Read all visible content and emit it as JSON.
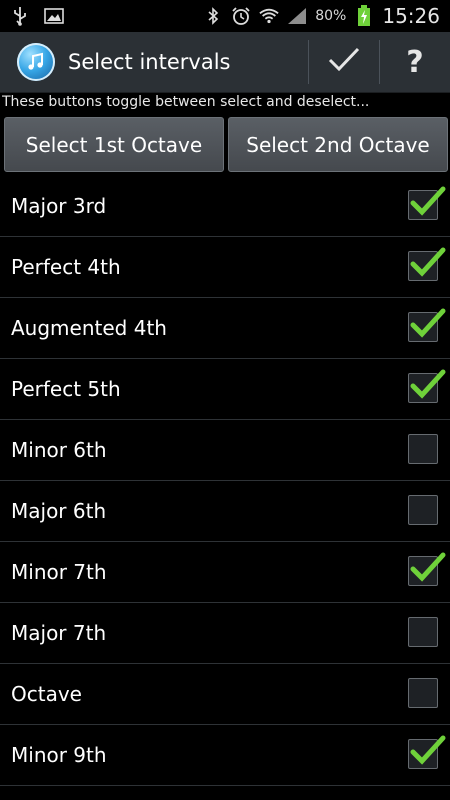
{
  "status_bar": {
    "battery_percent": "80%",
    "time": "15:26",
    "icons": [
      "usb-icon",
      "image-icon",
      "bluetooth-icon",
      "alarm-icon",
      "wifi-icon",
      "signal-icon",
      "battery-charging-icon"
    ]
  },
  "action_bar": {
    "title": "Select intervals",
    "app_icon": "music-app-icon",
    "confirm_icon": "checkmark-icon",
    "help_label": "?"
  },
  "hint_text": "These buttons toggle between select and deselect...",
  "buttons": {
    "first_octave": "Select 1st Octave",
    "second_octave": "Select 2nd Octave"
  },
  "intervals": [
    {
      "label": "Major 3rd",
      "checked": true
    },
    {
      "label": "Perfect 4th",
      "checked": true
    },
    {
      "label": "Augmented 4th",
      "checked": true
    },
    {
      "label": "Perfect 5th",
      "checked": true
    },
    {
      "label": "Minor 6th",
      "checked": false
    },
    {
      "label": "Major 6th",
      "checked": false
    },
    {
      "label": "Minor 7th",
      "checked": true
    },
    {
      "label": "Major 7th",
      "checked": false
    },
    {
      "label": "Octave",
      "checked": false
    },
    {
      "label": "Minor 9th",
      "checked": true
    }
  ],
  "colors": {
    "checkmark": "#6fd13a",
    "action_bar": "#2b3035",
    "background": "#000000"
  }
}
